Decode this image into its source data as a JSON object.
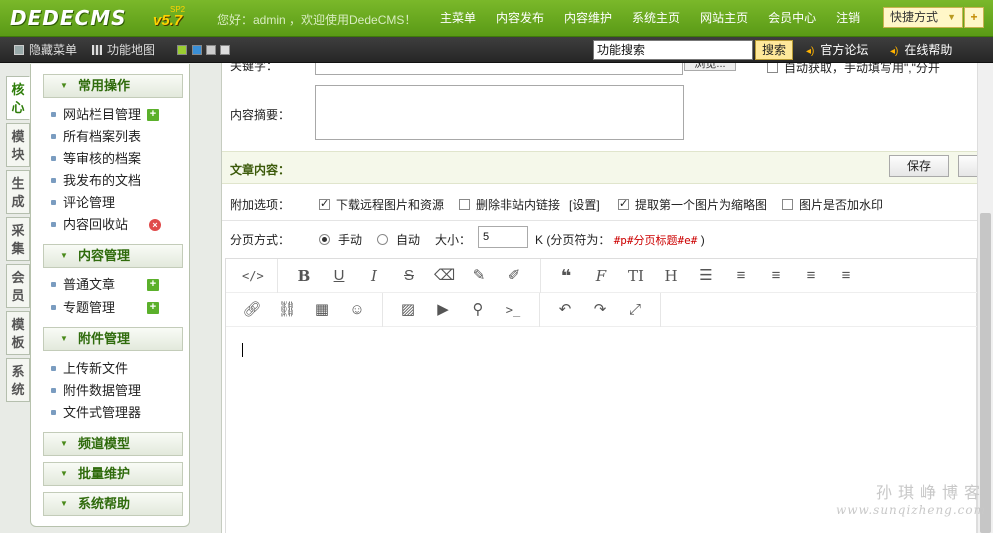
{
  "header": {
    "logo": "DEDECMS",
    "version": "v5.7",
    "version_tag": "SP2",
    "greeting": "您好：admin ，欢迎使用DedeCMS！",
    "nav": [
      "主菜单",
      "内容发布",
      "内容维护",
      "系统主页",
      "网站主页",
      "会员中心",
      "注销"
    ],
    "quick_menu": "快捷方式",
    "quick_add": "+"
  },
  "subbar": {
    "hide_menu": "隐藏菜单",
    "site_map": "功能地图",
    "skin_colors": [
      "#9acd32",
      "#3a8fd6",
      "#cccccc",
      "#dddddd"
    ],
    "search_value": "功能搜索",
    "search_button": "搜索",
    "forum": "官方论坛",
    "help": "在线帮助"
  },
  "vtabs": [
    "核心",
    "模块",
    "生成",
    "采集",
    "会员",
    "模板",
    "系统"
  ],
  "menu": {
    "groups": {
      "common": "常用操作",
      "content": "内容管理",
      "attach": "附件管理",
      "channel": "频道模型",
      "batch": "批量维护",
      "help": "系统帮助"
    },
    "common_items": [
      "网站栏目管理",
      "所有档案列表",
      "等审核的档案",
      "我发布的文档",
      "评论管理",
      "内容回收站"
    ],
    "content_items": [
      "普通文章",
      "专题管理"
    ],
    "attach_items": [
      "上传新文件",
      "附件数据管理",
      "文件式管理器"
    ]
  },
  "form": {
    "keywords_label": "关键字：",
    "browse_btn": "浏览...",
    "auto_keywords": "自动获取，手动填写用\",\"分开",
    "summary_label": "内容摘要：",
    "section_title": "文章内容：",
    "save_btn": "保存",
    "extra_label": "附加选项：",
    "opt_download": "下载远程图片和资源",
    "opt_remove_links": "删除非站内链接",
    "opt_settings": "[设置]",
    "opt_thumb": "提取第一个图片为缩略图",
    "opt_watermark": "图片是否加水印",
    "paging_label": "分页方式：",
    "paging_manual": "手动",
    "paging_auto": "自动",
    "size_label": "大小：",
    "size_value": "5",
    "size_unit": "K (分页符为：",
    "page_tag": "#p#分页标题#e#",
    "size_close": ")"
  },
  "editor_tools": {
    "row1": [
      "code-icon",
      "bold-icon",
      "underline-icon",
      "italic-icon",
      "strikethrough-icon",
      "eraser-icon",
      "pencil-icon",
      "brush-icon",
      "quote-icon",
      "font-icon",
      "text-size-icon",
      "heading-icon",
      "bullet-list-icon",
      "numbered-list-icon",
      "align-left-icon",
      "align-center-icon",
      "align-right-icon"
    ],
    "row2": [
      "link-icon",
      "unlink-icon",
      "table-icon",
      "emoji-icon",
      "image-icon",
      "video-icon",
      "map-pin-icon",
      "terminal-icon",
      "undo-icon",
      "redo-icon",
      "fullscreen-icon"
    ]
  },
  "watermark": {
    "line1": "孙琪峥博客",
    "line2": "www.sunqizheng.com"
  }
}
